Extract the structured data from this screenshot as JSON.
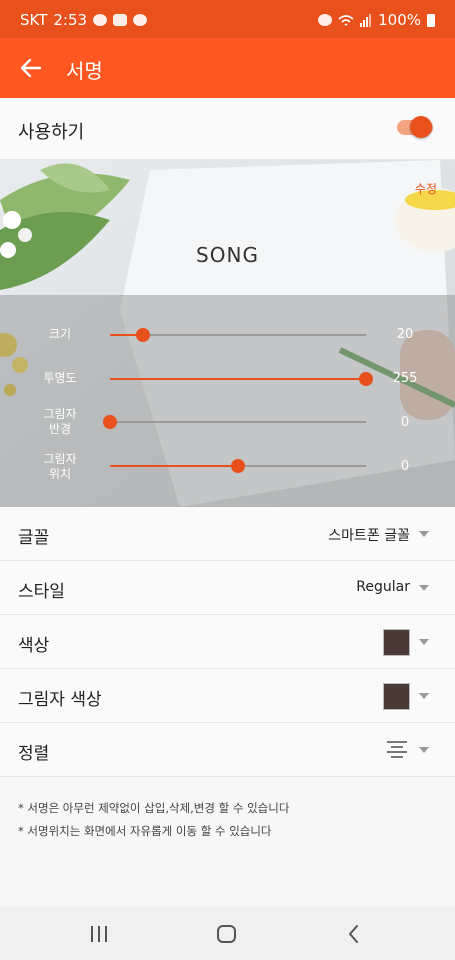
{
  "status_bar": {
    "carrier": "SKT",
    "time": "2:53",
    "battery": "100%",
    "icons": [
      "talk-notification-icon",
      "gallery-icon",
      "talk-notification-icon",
      "alarm-icon",
      "wifi-icon",
      "signal-icon",
      "battery-icon"
    ]
  },
  "app_bar": {
    "title": "서명",
    "back_icon": "arrow-left-icon"
  },
  "use_toggle": {
    "label": "사용하기",
    "on": true
  },
  "preview": {
    "edit_label": "수정",
    "signature_text": "SONG",
    "sliders": [
      {
        "label": "크기",
        "value": "20",
        "fraction": 0.13
      },
      {
        "label": "투명도",
        "value": "255",
        "fraction": 1.0
      },
      {
        "label": "그림자\n반경",
        "value": "0",
        "fraction": 0.0
      },
      {
        "label": "그림자\n위치",
        "value": "0",
        "fraction": 0.5
      }
    ]
  },
  "settings": {
    "font": {
      "label": "글꼴",
      "value": "스마트폰 글꼴"
    },
    "style": {
      "label": "스타일",
      "value": "Regular"
    },
    "color": {
      "label": "색상",
      "swatch": "#4a3a36"
    },
    "shadow_color": {
      "label": "그림자 색상",
      "swatch": "#4a3a36"
    },
    "align": {
      "label": "정렬",
      "icon": "align-center-icon"
    }
  },
  "notes": [
    "* 서명은 아무런 제약없이 삽입,삭제,변경 할 수 있습니다",
    "* 서명위치는 화면에서 자유롭게 이동 할 수 있습니다"
  ],
  "colors": {
    "status_bar": "#e8501c",
    "app_bar": "#ff5722",
    "accent": "#e8501c"
  },
  "nav_bar": {
    "buttons": [
      "recent-apps-icon",
      "home-icon",
      "back-icon"
    ]
  }
}
